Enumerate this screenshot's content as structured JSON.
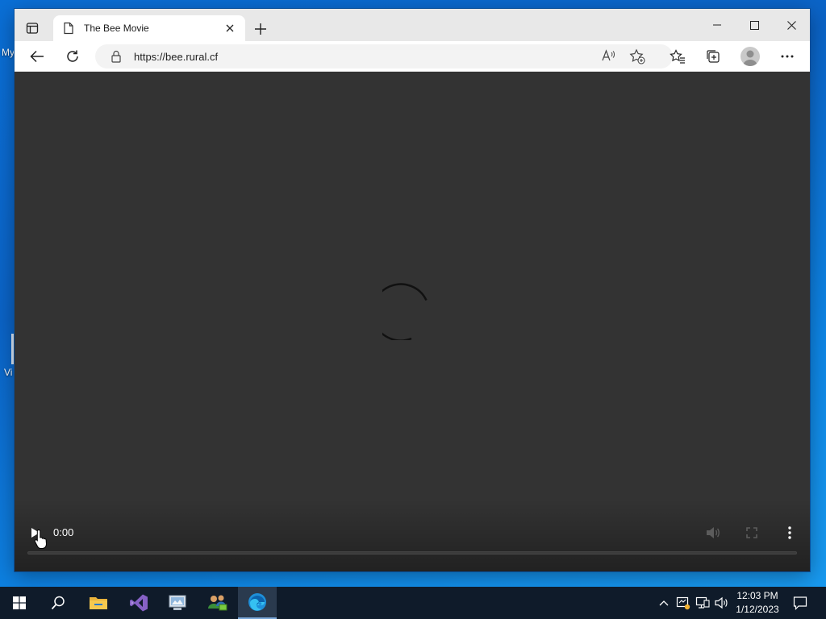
{
  "desktop": {
    "label_top": "My",
    "label_mid": "Vi"
  },
  "browser": {
    "tab": {
      "title": "The Bee Movie"
    },
    "address": {
      "url": "https://bee.rural.cf"
    }
  },
  "video": {
    "time": "0:00",
    "progress": 0
  },
  "taskbar": {
    "clock_time": "12:03 PM",
    "clock_date": "1/12/2023"
  },
  "colors": {
    "desktop_bg": "#0b63c6",
    "video_bg": "#333333",
    "taskbar_bg": "#0f1b2a"
  }
}
